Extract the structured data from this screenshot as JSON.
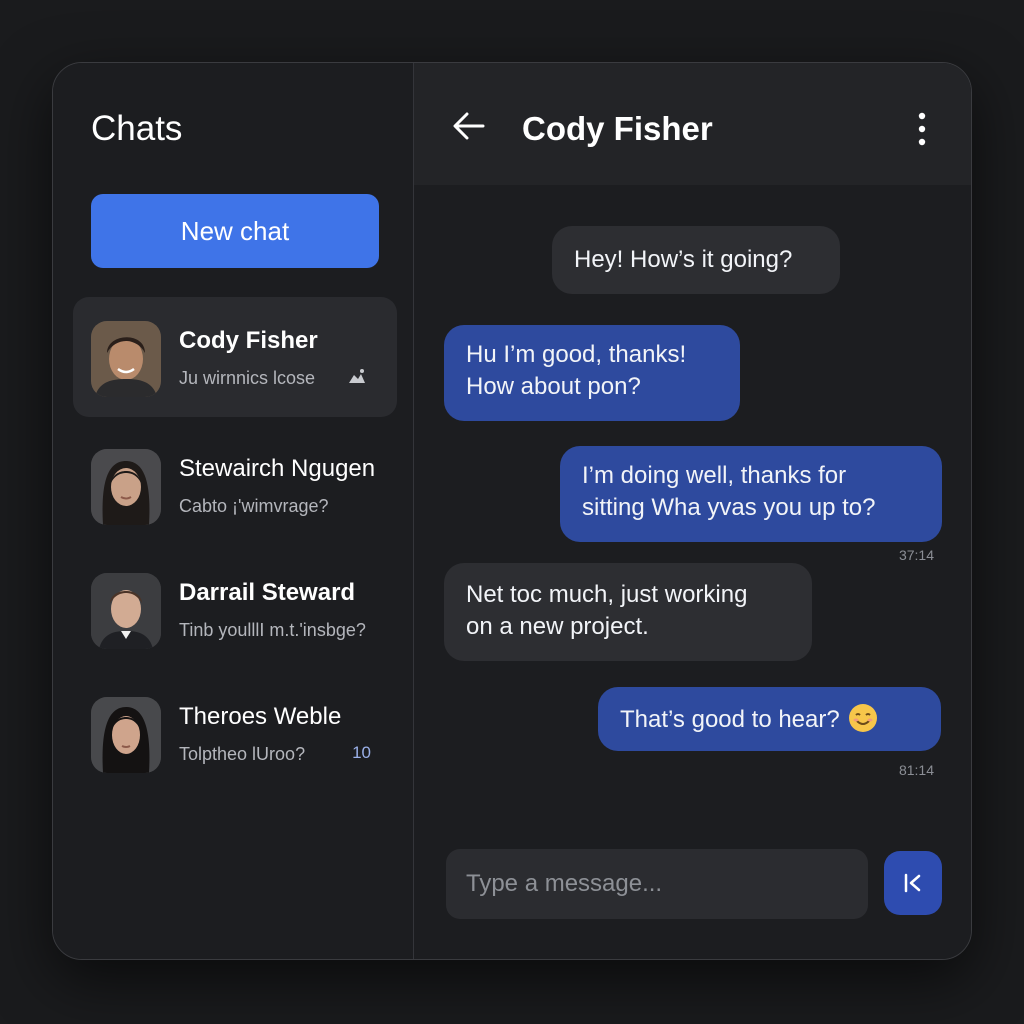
{
  "sidebar": {
    "title": "Chats",
    "new_chat_label": "New chat",
    "contacts": [
      {
        "name": "Cody Fisher",
        "preview": "Ju wirnnics lcose",
        "meta_icon": "image-icon",
        "active": true
      },
      {
        "name": "Stewairch Ngugen",
        "preview": "Cabto ¡'wimvrage?",
        "active": false
      },
      {
        "name": "Darrail Steward",
        "preview": "Tinb youlllI m.t.'insbge?",
        "active": false
      },
      {
        "name": "Theroes Weble",
        "preview": "Tolptheo lUroo?",
        "meta": "10",
        "active": false
      }
    ]
  },
  "chat": {
    "title": "Cody Fisher",
    "back_icon": "arrow-left-icon",
    "menu_icon": "more-vertical-icon",
    "messages": [
      {
        "from": "them",
        "lines": [
          "Hey! How’s it going?"
        ]
      },
      {
        "from": "me",
        "lines": [
          "Hu I’m good, thanks!",
          "How about pon?"
        ]
      },
      {
        "from": "me",
        "lines": [
          "I’m doing well, thanks for",
          "sitting  Wha yvas you up to?"
        ],
        "time": "37:14"
      },
      {
        "from": "them",
        "lines": [
          "Net toc much, just working",
          "on a new project."
        ]
      },
      {
        "from": "me",
        "lines": [
          "That’s good to hear?"
        ],
        "emoji": "smile-emoji",
        "time": "81:14"
      }
    ],
    "composer_placeholder": "Type a message...",
    "send_icon": "send-icon"
  },
  "colors": {
    "accent": "#3f74e8",
    "outgoing_bubble": "#2e4a9e",
    "incoming_bubble": "#2d2e32",
    "background": "#1c1d20"
  }
}
